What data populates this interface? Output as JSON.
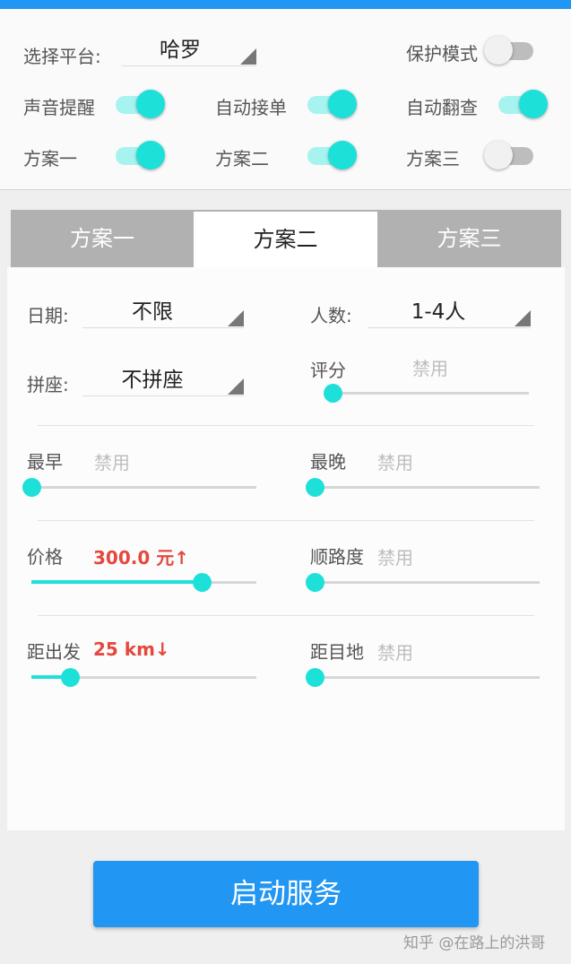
{
  "colors": {
    "accent": "#1de0d9",
    "primary": "#2196f3",
    "highlight": "#e5483f"
  },
  "platform": {
    "label": "选择平台:",
    "value": "哈罗"
  },
  "toggles": {
    "protect_mode": {
      "label": "保护模式",
      "on": false
    },
    "sound_alert": {
      "label": "声音提醒",
      "on": true
    },
    "auto_accept": {
      "label": "自动接单",
      "on": true
    },
    "auto_check": {
      "label": "自动翻查",
      "on": true
    },
    "plan1": {
      "label": "方案一",
      "on": true
    },
    "plan2": {
      "label": "方案二",
      "on": true
    },
    "plan3": {
      "label": "方案三",
      "on": false
    }
  },
  "tabs": [
    {
      "label": "方案一",
      "active": false
    },
    {
      "label": "方案二",
      "active": true
    },
    {
      "label": "方案三",
      "active": false
    }
  ],
  "settings": {
    "date": {
      "label": "日期:",
      "value": "不限"
    },
    "people": {
      "label": "人数:",
      "value": "1-4人"
    },
    "carpool": {
      "label": "拼座:",
      "value": "不拼座"
    },
    "rating": {
      "label": "评分",
      "value": "禁用",
      "level": 0
    },
    "earliest": {
      "label": "最早",
      "value": "禁用",
      "level": 0
    },
    "latest": {
      "label": "最晚",
      "value": "禁用",
      "level": 0
    },
    "price": {
      "label": "价格",
      "value": "300.0 元↑",
      "level": 0.756
    },
    "route": {
      "label": "顺路度",
      "value": "禁用",
      "level": 0
    },
    "from_distance": {
      "label": "距出发",
      "value": "25 km↓",
      "level": 0.172
    },
    "to_distance": {
      "label": "距目地",
      "value": "禁用",
      "level": 0
    }
  },
  "start_button": {
    "label": "启动服务"
  },
  "watermark": "知乎 @在路上的洪哥"
}
